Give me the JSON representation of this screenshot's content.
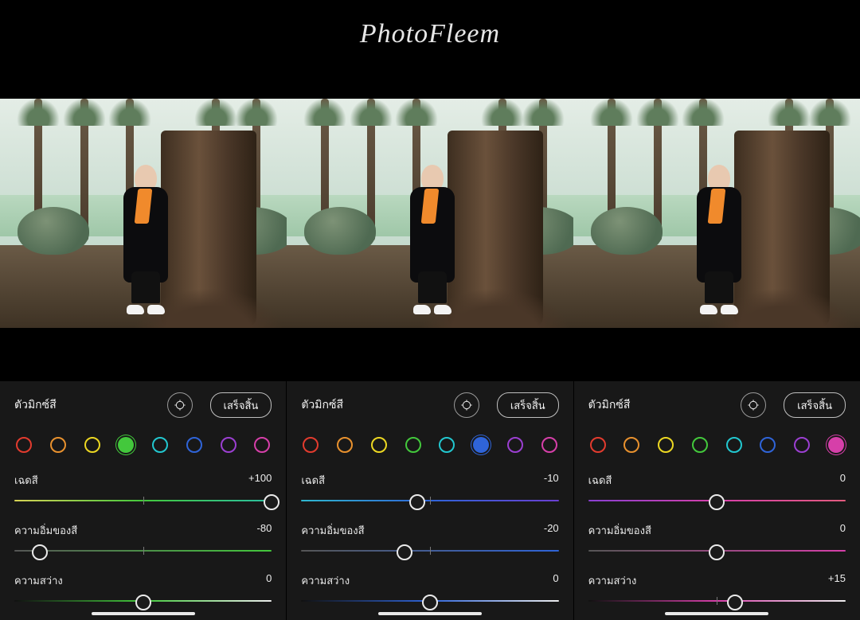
{
  "watermark": "PhotoFleem",
  "swatch_colors": [
    "#e23b2e",
    "#e8912e",
    "#ecd722",
    "#43c83c",
    "#22c7cf",
    "#2f64d8",
    "#9b3fd1",
    "#d63fa9"
  ],
  "panels": [
    {
      "title": "ตัวมิกซ์สี",
      "done_label": "เสร็จสิ้น",
      "selected_swatch": 3,
      "accent": "#43c83c",
      "grad": [
        "#d7d255",
        "#43c83c",
        "#2bbfa2"
      ],
      "sliders": [
        {
          "label": "เฉดสี",
          "value": "+100",
          "pos": 100
        },
        {
          "label": "ความอิ่มของสี",
          "value": "-80",
          "pos": 10
        },
        {
          "label": "ความสว่าง",
          "value": "0",
          "pos": 50
        }
      ]
    },
    {
      "title": "ตัวมิกซ์สี",
      "done_label": "เสร็จสิ้น",
      "selected_swatch": 5,
      "accent": "#2f64d8",
      "grad": [
        "#2fb7cf",
        "#2f64d8",
        "#6a3fd1"
      ],
      "sliders": [
        {
          "label": "เฉดสี",
          "value": "-10",
          "pos": 45
        },
        {
          "label": "ความอิ่มของสี",
          "value": "-20",
          "pos": 40
        },
        {
          "label": "ความสว่าง",
          "value": "0",
          "pos": 50
        }
      ]
    },
    {
      "title": "ตัวมิกซ์สี",
      "done_label": "เสร็จสิ้น",
      "selected_swatch": 7,
      "accent": "#d63fa9",
      "grad": [
        "#8a3fd1",
        "#d63fa9",
        "#e25b7e"
      ],
      "sliders": [
        {
          "label": "เฉดสี",
          "value": "0",
          "pos": 50
        },
        {
          "label": "ความอิ่มของสี",
          "value": "0",
          "pos": 50
        },
        {
          "label": "ความสว่าง",
          "value": "+15",
          "pos": 57
        }
      ]
    }
  ]
}
